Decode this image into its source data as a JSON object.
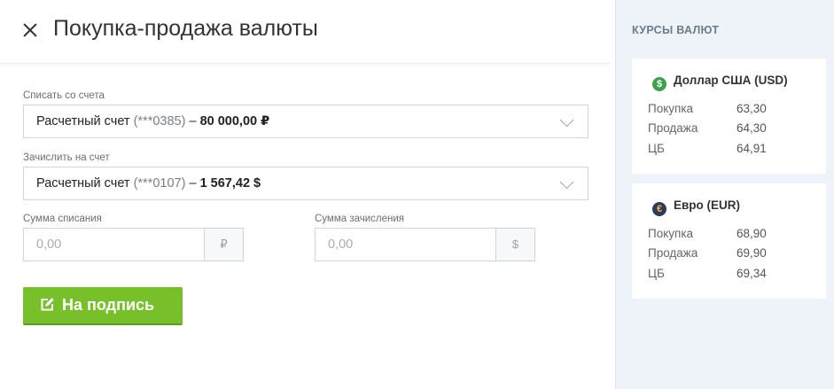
{
  "header": {
    "title": "Покупка-продажа валюты"
  },
  "form": {
    "debit_label": "Списать со счета",
    "debit_account": {
      "name": "Расчетный счет",
      "number": "(***0385)",
      "dash": "–",
      "balance": "80 000,00 ₽"
    },
    "credit_label": "Зачислить на счет",
    "credit_account": {
      "name": "Расчетный счет",
      "number": "(***0107)",
      "dash": "–",
      "balance": "1 567,42 $"
    },
    "debit_amount_label": "Сумма списания",
    "debit_amount_placeholder": "0,00",
    "debit_currency": "₽",
    "credit_amount_label": "Сумма зачисления",
    "credit_amount_placeholder": "0,00",
    "credit_currency": "$",
    "submit_label": "На подпись"
  },
  "rates": {
    "heading": "КУРСЫ ВАЛЮТ",
    "cards": [
      {
        "coin": "$",
        "title": "Доллар США (USD)",
        "rows": [
          {
            "label": "Покупка",
            "value": "63,30"
          },
          {
            "label": "Продажа",
            "value": "64,30"
          },
          {
            "label": "ЦБ",
            "value": "64,91"
          }
        ]
      },
      {
        "coin": "€",
        "title": "Евро (EUR)",
        "rows": [
          {
            "label": "Покупка",
            "value": "68,90"
          },
          {
            "label": "Продажа",
            "value": "69,90"
          },
          {
            "label": "ЦБ",
            "value": "69,34"
          }
        ]
      }
    ]
  },
  "colors": {
    "accent_green": "#78c02a",
    "usd_icon": "#3fa24a",
    "eur_icon": "#2d3b5c",
    "sidebar_bg": "#eef3f9"
  },
  "icons": {
    "close": "close-icon",
    "select_arrow": "chevron-down-icon",
    "submit": "edit-icon",
    "usd": "dollar-coin-icon",
    "eur": "euro-coin-icon"
  }
}
